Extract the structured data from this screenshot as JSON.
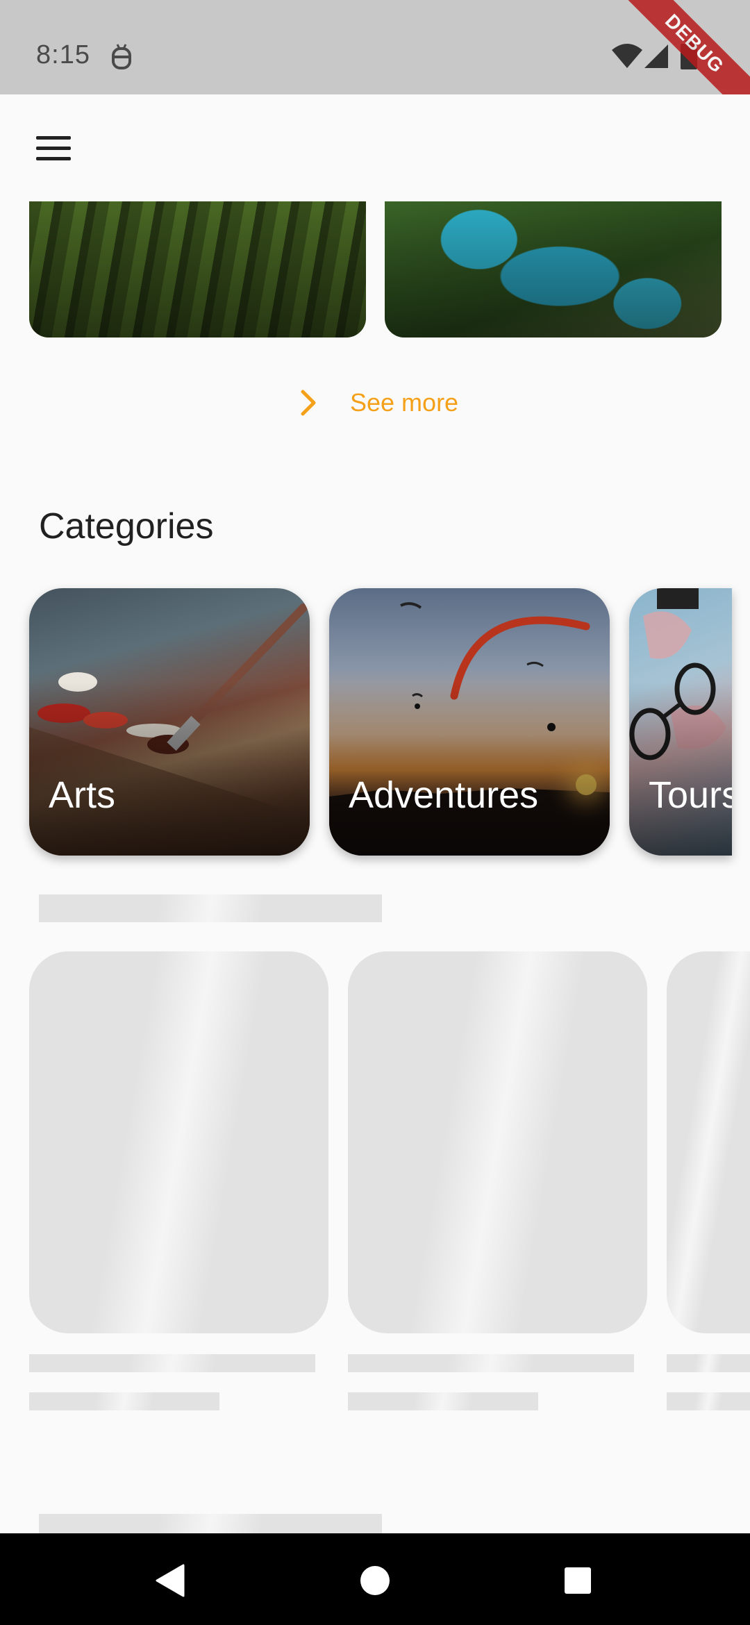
{
  "status_bar": {
    "time": "8:15",
    "icons": [
      "android-debug-icon",
      "wifi-icon",
      "signal-icon",
      "battery-icon"
    ],
    "debug_badge": "DEBUG"
  },
  "app_bar": {
    "menu_icon": "menu-icon"
  },
  "see_more": {
    "label": "See more",
    "icon": "chevron-right-icon"
  },
  "categories": {
    "title": "Categories",
    "items": [
      {
        "label": "Arts"
      },
      {
        "label": "Adventures"
      },
      {
        "label": "Tours"
      }
    ]
  },
  "navigation": {
    "icons": [
      "back-icon",
      "home-icon",
      "recents-icon"
    ]
  },
  "colors": {
    "accent": "#f5a019",
    "skeleton": "#e2e2e2",
    "status_bar": "#c8c8c8",
    "debug": "#b71c1c"
  }
}
